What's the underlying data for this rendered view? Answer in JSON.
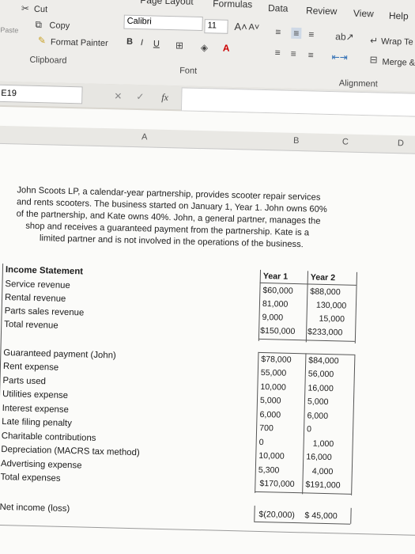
{
  "ribbon": {
    "tabs": [
      "Page Layout",
      "Formulas",
      "Data",
      "Review",
      "View",
      "Help"
    ],
    "clipboard": {
      "cut": "Cut",
      "copy": "Copy",
      "paste": "Paste",
      "format_painter": "Format Painter",
      "group": "Clipboard"
    },
    "font": {
      "name": "Calibri",
      "size": "11",
      "group": "Font",
      "bold": "B",
      "italic": "I",
      "underline": "U"
    },
    "alignment": {
      "wrap": "Wrap Te",
      "merge": "Merge &",
      "group": "Alignment"
    }
  },
  "formula_bar": {
    "cell": "E19",
    "fx": "fx"
  },
  "columns": [
    "A",
    "B",
    "C",
    "D"
  ],
  "description": [
    "John Scoots LP, a calendar-year partnership, provides scooter repair services",
    "and rents scooters. The business started on January 1, Year 1. John owns 60%",
    "of the partnership, and Kate owns 40%. John, a general partner, manages the",
    "shop and receives a guaranteed payment from the partnership. Kate is a",
    "limited partner and is not involved in the operations of the business."
  ],
  "table": {
    "title": "Income Statement",
    "year1": "Year 1",
    "year2": "Year 2",
    "revenue": [
      {
        "row": "3",
        "label": "Service revenue",
        "y1": "$60,000",
        "y2": "$88,000"
      },
      {
        "row": "4",
        "label": "Rental revenue",
        "y1": "81,000",
        "y2": "130,000"
      },
      {
        "row": "5",
        "label": "Parts sales revenue",
        "y1": "9,000",
        "y2": "15,000"
      },
      {
        "row": "6",
        "label": "Total revenue",
        "y1": "$150,000",
        "y2": "$233,000"
      }
    ],
    "expenses": [
      {
        "row": "8",
        "label": "Guaranteed payment (John)",
        "y1": "$78,000",
        "y2": "$84,000"
      },
      {
        "row": "9",
        "label": "Rent expense",
        "y1": "55,000",
        "y2": "56,000"
      },
      {
        "row": "10",
        "label": "Parts used",
        "y1": "10,000",
        "y2": "16,000"
      },
      {
        "row": "11",
        "label": "Utilities expense",
        "y1": "5,000",
        "y2": "5,000"
      },
      {
        "row": "12",
        "label": "Interest expense",
        "y1": "6,000",
        "y2": "6,000"
      },
      {
        "row": "13",
        "label": "Late filing penalty",
        "y1": "700",
        "y2": "0"
      },
      {
        "row": "14",
        "label": "Charitable contributions",
        "y1": "0",
        "y2": "1,000"
      },
      {
        "row": "15",
        "label": "Depreciation (MACRS tax method)",
        "y1": "10,000",
        "y2": "16,000"
      },
      {
        "row": "16",
        "label": "Advertising expense",
        "y1": "5,300",
        "y2": "4,000"
      },
      {
        "row": "17",
        "label": "Total expenses",
        "y1": "$170,000",
        "y2": "$191,000"
      }
    ],
    "net": {
      "row": "19",
      "label": "Net income (loss)",
      "y1": "$(20,000)",
      "y2": "$ 45,000"
    },
    "row_labels": [
      "1",
      "2",
      "7",
      "18",
      "20"
    ]
  }
}
